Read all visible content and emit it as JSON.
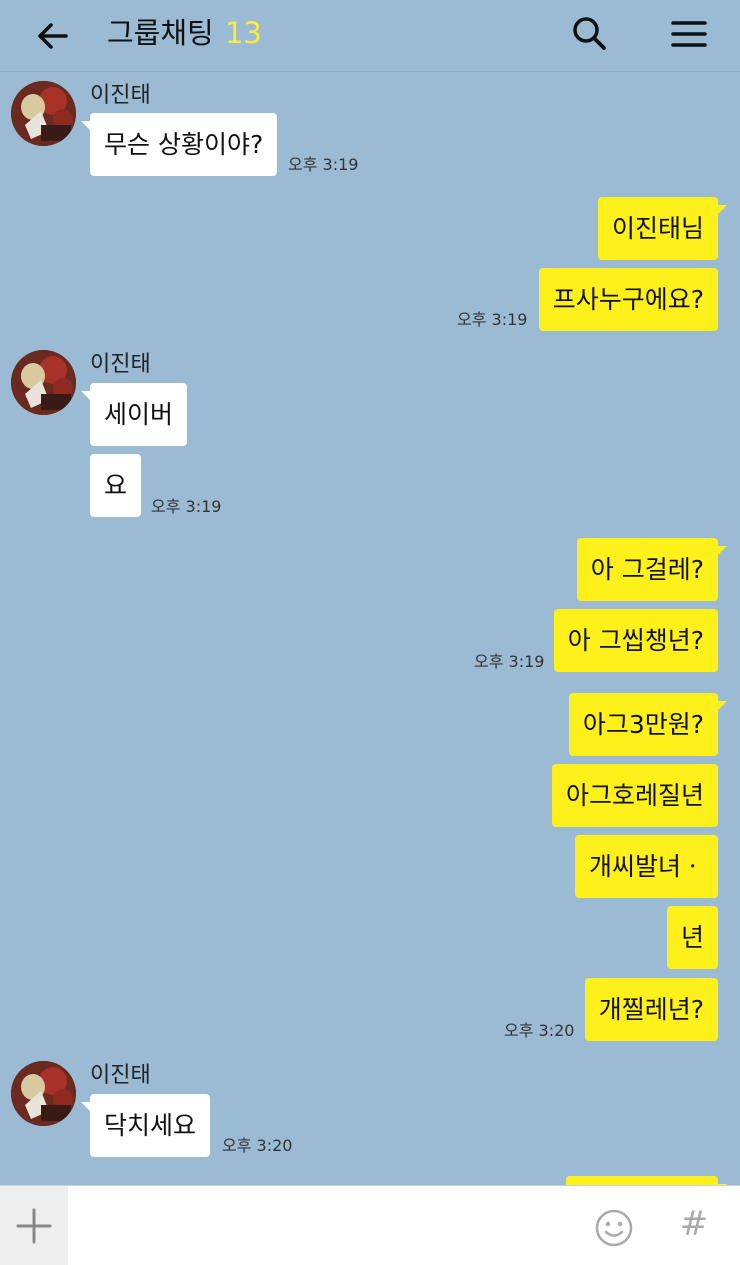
{
  "header": {
    "title": "그룹채팅",
    "member_count": "13",
    "back_icon": "arrow-left-icon",
    "search_icon": "search-icon",
    "menu_icon": "hamburger-menu-icon"
  },
  "colors": {
    "background": "#9bbbd4",
    "outgoing_bubble": "#fef01b",
    "incoming_bubble": "#ffffff",
    "count_accent": "#ffeb3b"
  },
  "messages": [
    {
      "sender": "이진태",
      "text": "무슨 상황이야?",
      "time": "오후 3:19"
    },
    {
      "text": "이진태님"
    },
    {
      "text": "프사누구에요?",
      "time": "오후 3:19"
    },
    {
      "sender": "이진태",
      "text": "세이버"
    },
    {
      "text": "요",
      "time": "오후 3:19"
    },
    {
      "text": "아 그걸레?"
    },
    {
      "text": "아 그씹챙년?",
      "time": "오후 3:19"
    },
    {
      "text": "아그3만원?"
    },
    {
      "text": "아그호레질년"
    },
    {
      "text": "개씨발녀ㆍ"
    },
    {
      "text": "년"
    },
    {
      "text": "개찔레년?",
      "time": "오후 3:20"
    },
    {
      "sender": "이진태",
      "text": "닥치세요",
      "time": "오후 3:20"
    }
  ],
  "input": {
    "value": "",
    "plus_icon": "plus-icon",
    "emoji_icon": "smiley-icon",
    "hash_label": "#"
  }
}
